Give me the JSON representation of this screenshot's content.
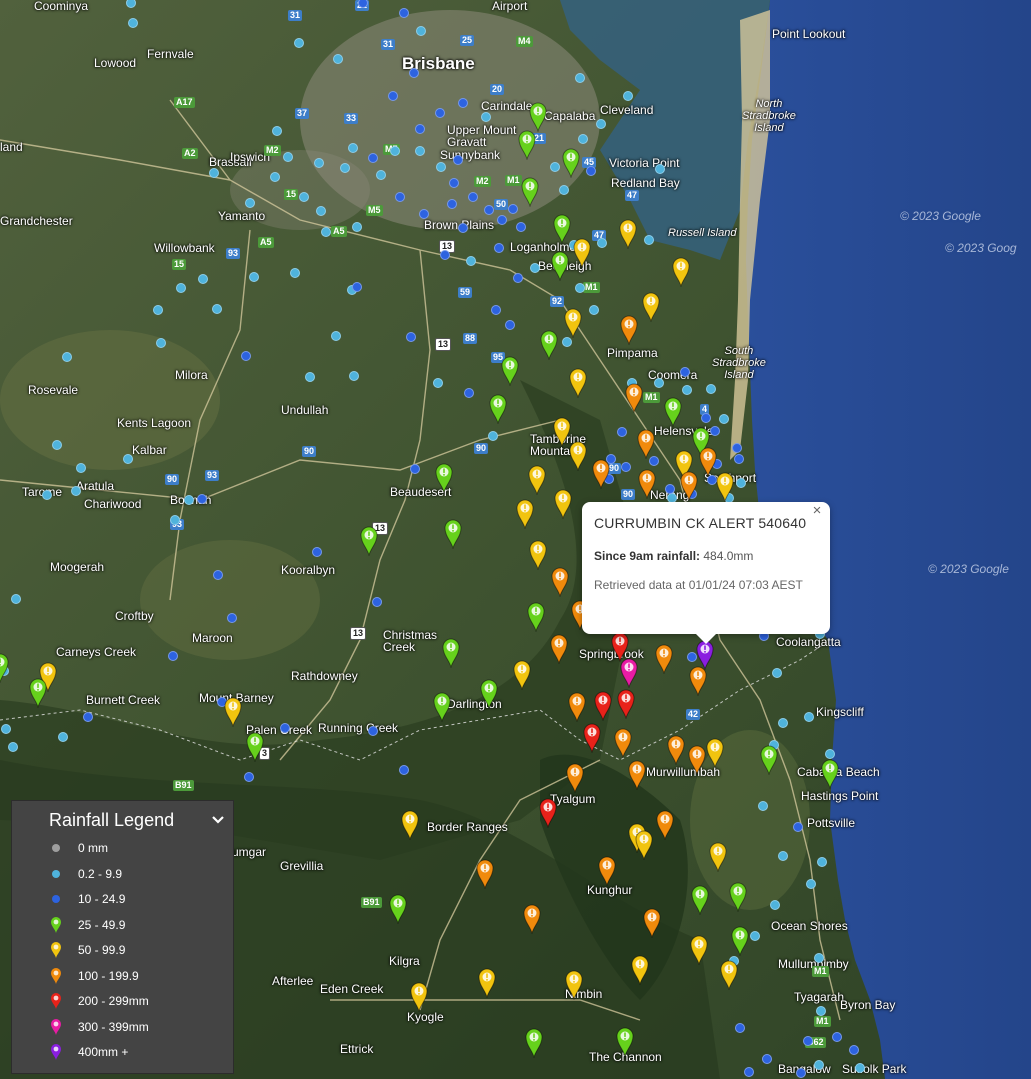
{
  "map": {
    "places": [
      {
        "text": "Brisbane",
        "cls": "city"
      },
      {
        "text": "Coominya",
        "cls": ""
      },
      {
        "text": "Fernvale",
        "cls": ""
      },
      {
        "text": "Lowood",
        "cls": ""
      },
      {
        "text": "Airport",
        "cls": ""
      },
      {
        "text": "Point Lookout",
        "cls": ""
      },
      {
        "text": "North\nStradbroke\nIsland",
        "cls": "island"
      },
      {
        "text": "Carindale",
        "cls": ""
      },
      {
        "text": "Capalaba",
        "cls": ""
      },
      {
        "text": "Cleveland",
        "cls": ""
      },
      {
        "text": "Upper Mount\nGravatt",
        "cls": ""
      },
      {
        "text": "Sunnybank",
        "cls": ""
      },
      {
        "text": "Victoria Point",
        "cls": ""
      },
      {
        "text": "Redland Bay",
        "cls": ""
      },
      {
        "text": "land",
        "cls": ""
      },
      {
        "text": "Brassall",
        "cls": ""
      },
      {
        "text": "Ipswich",
        "cls": ""
      },
      {
        "text": "Grandchester",
        "cls": ""
      },
      {
        "text": "Yamanto",
        "cls": ""
      },
      {
        "text": "Willowbank",
        "cls": ""
      },
      {
        "text": "Brown Plains",
        "cls": ""
      },
      {
        "text": "Loganholme",
        "cls": ""
      },
      {
        "text": "Beenleigh",
        "cls": ""
      },
      {
        "text": "Russell Island",
        "cls": "island"
      },
      {
        "text": "Pimpama",
        "cls": ""
      },
      {
        "text": "Coomera",
        "cls": ""
      },
      {
        "text": "South\nStradbroke\nIsland",
        "cls": "island"
      },
      {
        "text": "Milora",
        "cls": ""
      },
      {
        "text": "Rosevale",
        "cls": ""
      },
      {
        "text": "Undullah",
        "cls": ""
      },
      {
        "text": "Kents Lagoon",
        "cls": ""
      },
      {
        "text": "Kalbar",
        "cls": ""
      },
      {
        "text": "Aratula",
        "cls": ""
      },
      {
        "text": "Tarome",
        "cls": ""
      },
      {
        "text": "Chariwood",
        "cls": ""
      },
      {
        "text": "Boonah",
        "cls": ""
      },
      {
        "text": "Tamborine\nMountain",
        "cls": ""
      },
      {
        "text": "Helensvale",
        "cls": ""
      },
      {
        "text": "Nerang",
        "cls": ""
      },
      {
        "text": "Southport",
        "cls": ""
      },
      {
        "text": "Beaudesert",
        "cls": ""
      },
      {
        "text": "Moogerah",
        "cls": ""
      },
      {
        "text": "Kooralbyn",
        "cls": ""
      },
      {
        "text": "Croftby",
        "cls": ""
      },
      {
        "text": "Maroon",
        "cls": ""
      },
      {
        "text": "Christmas\nCreek",
        "cls": ""
      },
      {
        "text": "Carneys Creek",
        "cls": ""
      },
      {
        "text": "Rathdowney",
        "cls": ""
      },
      {
        "text": "Springbrook",
        "cls": ""
      },
      {
        "text": "Coolangatta",
        "cls": ""
      },
      {
        "text": "Burnett Creek",
        "cls": ""
      },
      {
        "text": "Mount Barney",
        "cls": ""
      },
      {
        "text": "Darlington",
        "cls": ""
      },
      {
        "text": "Kingscliff",
        "cls": ""
      },
      {
        "text": "Palen Creek",
        "cls": ""
      },
      {
        "text": "Running Creek",
        "cls": ""
      },
      {
        "text": "Murwillumbah",
        "cls": ""
      },
      {
        "text": "Cabarita Beach",
        "cls": ""
      },
      {
        "text": "Hastings Point",
        "cls": ""
      },
      {
        "text": "Tyalgum",
        "cls": ""
      },
      {
        "text": "Border Ranges",
        "cls": ""
      },
      {
        "text": "Pottsville",
        "cls": ""
      },
      {
        "text": "umgar",
        "cls": ""
      },
      {
        "text": "Grevillia",
        "cls": ""
      },
      {
        "text": "Kunghur",
        "cls": ""
      },
      {
        "text": "Ocean Shores",
        "cls": ""
      },
      {
        "text": "Mullumbimby",
        "cls": ""
      },
      {
        "text": "Kilgra",
        "cls": ""
      },
      {
        "text": "Afterlee",
        "cls": ""
      },
      {
        "text": "Eden Creek",
        "cls": ""
      },
      {
        "text": "Kyogle",
        "cls": ""
      },
      {
        "text": "Nimbin",
        "cls": ""
      },
      {
        "text": "Tyagarah",
        "cls": ""
      },
      {
        "text": "Byron Bay",
        "cls": ""
      },
      {
        "text": "Ettrick",
        "cls": ""
      },
      {
        "text": "The Channon",
        "cls": ""
      },
      {
        "text": "Bangalow",
        "cls": ""
      },
      {
        "text": "Suffolk Park",
        "cls": ""
      },
      {
        "text": "© 2023 Google",
        "cls": "ocean"
      },
      {
        "text": "© 2023 Goog",
        "cls": "ocean"
      },
      {
        "text": "© 2023 Google",
        "cls": "ocean"
      }
    ],
    "roads": [
      {
        "text": "31",
        "cls": "m"
      },
      {
        "text": "22",
        "cls": "m"
      },
      {
        "text": "31",
        "cls": "m"
      },
      {
        "text": "25",
        "cls": "m"
      },
      {
        "text": "M4",
        "cls": "g"
      },
      {
        "text": "20",
        "cls": "m"
      },
      {
        "text": "A17",
        "cls": "g"
      },
      {
        "text": "37",
        "cls": "m"
      },
      {
        "text": "33",
        "cls": "m"
      },
      {
        "text": "21",
        "cls": "m"
      },
      {
        "text": "45",
        "cls": "m"
      },
      {
        "text": "A2",
        "cls": "g"
      },
      {
        "text": "M2",
        "cls": "g"
      },
      {
        "text": "M7",
        "cls": "g"
      },
      {
        "text": "M2",
        "cls": "g"
      },
      {
        "text": "M1",
        "cls": "g"
      },
      {
        "text": "15",
        "cls": "g"
      },
      {
        "text": "47",
        "cls": "m"
      },
      {
        "text": "50",
        "cls": "m"
      },
      {
        "text": "M5",
        "cls": "g"
      },
      {
        "text": "A5",
        "cls": "g"
      },
      {
        "text": "47",
        "cls": "m"
      },
      {
        "text": "13",
        "cls": "w"
      },
      {
        "text": "A5",
        "cls": "g"
      },
      {
        "text": "93",
        "cls": "m"
      },
      {
        "text": "15",
        "cls": "g"
      },
      {
        "text": "59",
        "cls": "m"
      },
      {
        "text": "92",
        "cls": "m"
      },
      {
        "text": "M1",
        "cls": "g"
      },
      {
        "text": "13",
        "cls": "w"
      },
      {
        "text": "88",
        "cls": "m"
      },
      {
        "text": "95",
        "cls": "m"
      },
      {
        "text": "M1",
        "cls": "g"
      },
      {
        "text": "4",
        "cls": "m"
      },
      {
        "text": "90",
        "cls": "m"
      },
      {
        "text": "90",
        "cls": "m"
      },
      {
        "text": "90",
        "cls": "m"
      },
      {
        "text": "93",
        "cls": "m"
      },
      {
        "text": "90",
        "cls": "m"
      },
      {
        "text": "90",
        "cls": "m"
      },
      {
        "text": "93",
        "cls": "m"
      },
      {
        "text": "13",
        "cls": "w"
      },
      {
        "text": "13",
        "cls": "w"
      },
      {
        "text": "42",
        "cls": "m"
      },
      {
        "text": "B91",
        "cls": "g"
      },
      {
        "text": "B91",
        "cls": "g"
      },
      {
        "text": "3",
        "cls": "w"
      },
      {
        "text": "M1",
        "cls": "g"
      },
      {
        "text": "M1",
        "cls": "g"
      },
      {
        "text": "B62",
        "cls": "g"
      }
    ]
  },
  "popup": {
    "title": "CURRUMBIN CK ALERT 540640",
    "rain_label": "Since 9am rainfall:",
    "rain_value": " 484.0mm",
    "retrieved": "Retrieved data at 01/01/24 07:03 AEST",
    "close_label": "×"
  },
  "legend": {
    "title": "Rainfall Legend",
    "items": [
      {
        "label": "0 mm",
        "kind": "dot",
        "color": "#9e9e9e"
      },
      {
        "label": "0.2 - 9.9",
        "kind": "dot",
        "color": "#4fb3dc"
      },
      {
        "label": "10 - 24.9",
        "kind": "dot",
        "color": "#2d63e0"
      },
      {
        "label": "25 - 49.9",
        "kind": "pin",
        "color": "#66d11c"
      },
      {
        "label": "50 - 99.9",
        "kind": "pin",
        "color": "#f1c40f"
      },
      {
        "label": "100 - 199.9",
        "kind": "pin",
        "color": "#f08a0c"
      },
      {
        "label": "200 - 299mm",
        "kind": "pin",
        "color": "#e8221a"
      },
      {
        "label": "300 - 399mm",
        "kind": "pin",
        "color": "#e81ca4"
      },
      {
        "label": "400mm +",
        "kind": "pin",
        "color": "#8a1ee0"
      }
    ]
  },
  "colors": {
    "ocean": "#2b4f9e",
    "land": "#4a5a3a",
    "light_dot": "#4fb3dc",
    "dark_dot": "#2d63e0",
    "green": "#66d11c",
    "yellow": "#f1c40f",
    "orange": "#f08a0c",
    "red": "#e8221a",
    "magenta": "#e81ca4",
    "purple": "#8a1ee0"
  },
  "icons": {
    "popup_close": "close-icon",
    "legend_toggle": "chevron-down-icon",
    "marker": "exclamation-pin-icon"
  }
}
